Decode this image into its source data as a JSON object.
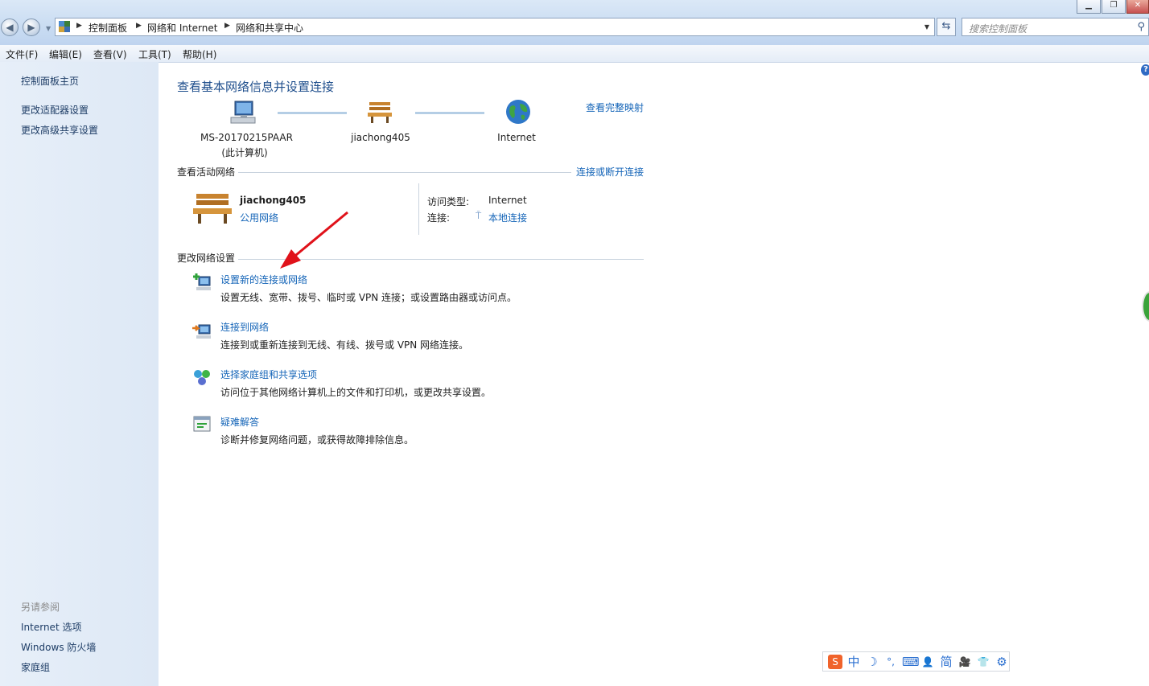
{
  "window": {
    "minimize": "▁",
    "restore": "❐",
    "close": "✕"
  },
  "address_bar": {
    "crumbs": [
      "控制面板",
      "网络和 Internet",
      "网络和共享中心"
    ],
    "search_placeholder": "搜索控制面板"
  },
  "menu": [
    "文件(F)",
    "编辑(E)",
    "查看(V)",
    "工具(T)",
    "帮助(H)"
  ],
  "sidebar": {
    "links": [
      "控制面板主页",
      "更改适配器设置",
      "更改高级共享设置"
    ],
    "see_also_heading": "另请参阅",
    "see_also": [
      "Internet 选项",
      "Windows 防火墙",
      "家庭组"
    ]
  },
  "main": {
    "title": "查看基本网络信息并设置连接",
    "full_map_link": "查看完整映射",
    "network_map": {
      "computer_name": "MS-20170215PAAR",
      "computer_note": "(此计算机)",
      "network_name": "jiachong405",
      "internet": "Internet"
    },
    "active_networks": {
      "heading": "查看活动网络",
      "connect_link": "连接或断开连接",
      "name": "jiachong405",
      "type": "公用网络",
      "access_type_label": "访问类型:",
      "access_type_value": "Internet",
      "connection_label": "连接:",
      "connection_value": "本地连接"
    },
    "change_settings": {
      "heading": "更改网络设置",
      "tasks": [
        {
          "title": "设置新的连接或网络",
          "desc": "设置无线、宽带、拨号、临时或 VPN 连接；或设置路由器或访问点。",
          "icon": "new-connection-icon"
        },
        {
          "title": "连接到网络",
          "desc": "连接到或重新连接到无线、有线、拨号或 VPN 网络连接。",
          "icon": "connect-network-icon"
        },
        {
          "title": "选择家庭组和共享选项",
          "desc": "访问位于其他网络计算机上的文件和打印机，或更改共享设置。",
          "icon": "homegroup-icon"
        },
        {
          "title": "疑难解答",
          "desc": "诊断并修复网络问题，或获得故障排除信息。",
          "icon": "troubleshoot-icon"
        }
      ]
    }
  },
  "ime_toolbar": [
    "中",
    "☽",
    "°,",
    "⌨",
    "👤",
    "简",
    "🎥",
    "👕",
    "⚙"
  ],
  "colors": {
    "link": "#1565b8",
    "title": "#1e4e8c",
    "arrow": "#e0121a"
  }
}
